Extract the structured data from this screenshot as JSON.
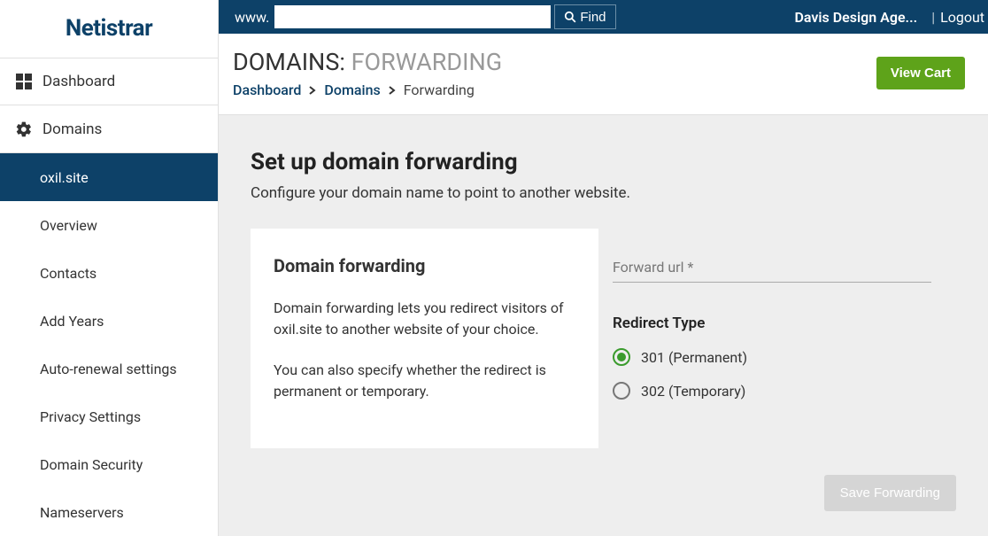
{
  "brand": "Netistrar",
  "topbar": {
    "www_label": "www.",
    "search_value": "",
    "find_label": "Find",
    "user_display": "Davis Design Age...",
    "separator": "|",
    "logout_label": "Logout"
  },
  "nav": {
    "dashboard_label": "Dashboard",
    "domains_label": "Domains",
    "sub": {
      "current_domain": "oxil.site",
      "overview": "Overview",
      "contacts": "Contacts",
      "add_years": "Add Years",
      "auto_renewal": "Auto-renewal settings",
      "privacy": "Privacy Settings",
      "security": "Domain Security",
      "nameservers": "Nameservers"
    }
  },
  "header": {
    "title_prefix": "DOMAINS:",
    "title_suffix": "FORWARDING",
    "breadcrumb": {
      "dashboard": "Dashboard",
      "domains": "Domains",
      "current": "Forwarding"
    },
    "view_cart": "View Cart"
  },
  "content": {
    "heading": "Set up domain forwarding",
    "subheading": "Configure your domain name to point to another website.",
    "left": {
      "title": "Domain forwarding",
      "para1": "Domain forwarding lets you redirect visitors of oxil.site to another website of your choice.",
      "para2": "You can also specify whether the redirect is permanent or temporary."
    },
    "right": {
      "forward_url_placeholder": "Forward url *",
      "forward_url_value": "",
      "redirect_type_label": "Redirect Type",
      "option_301": "301 (Permanent)",
      "option_302": "302 (Temporary)",
      "selected_option": "301",
      "save_label": "Save Forwarding"
    }
  },
  "colors": {
    "brand_navy": "#0d4168",
    "accent_green": "#5ea31a",
    "radio_green": "#3a9b2d",
    "page_bg": "#eeeeee"
  }
}
